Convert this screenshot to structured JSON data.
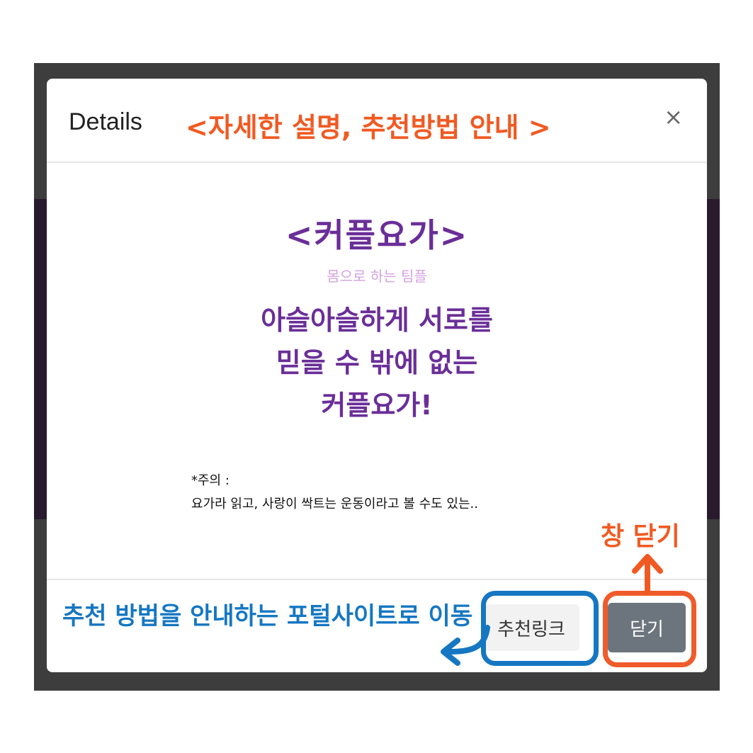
{
  "modal": {
    "title": "Details",
    "close_symbol": "×"
  },
  "content": {
    "title": "<커플요가>",
    "subtitle": "몸으로 하는 팀플",
    "lines": [
      "아슬아슬하게 서로를",
      "믿을 수 밖에 없는",
      "커플요가!"
    ],
    "notice_label": "*주의 :",
    "notice_text": "요가라 읽고, 사랑이 싹트는 운동이라고 볼 수도 있는.."
  },
  "footer": {
    "link_button": "추천링크",
    "close_button": "닫기"
  },
  "annotations": {
    "header": "<자세한 설명, 추천방법 안내 >",
    "close": "창 닫기",
    "link": "추천 방법을 안내하는 포털사이트로 이동"
  },
  "colors": {
    "annotation_orange": "#f05a22",
    "annotation_blue": "#1577c2",
    "content_purple": "#6a2e98",
    "button_gray": "#6c757d"
  },
  "icons": {
    "close": "close-icon",
    "arrow_up": "arrow-up-icon",
    "arrow_left": "arrow-left-icon"
  }
}
